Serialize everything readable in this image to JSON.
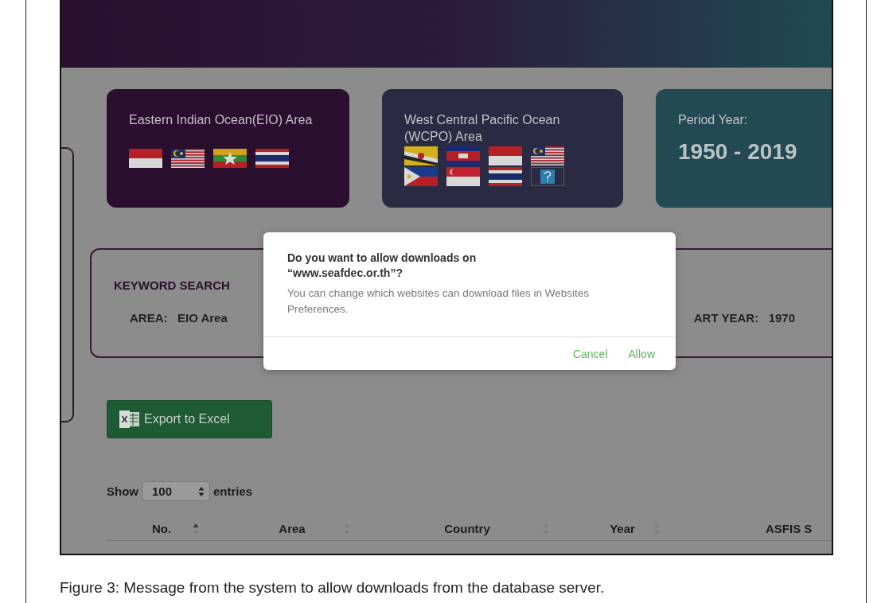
{
  "cards": [
    {
      "kind": "region",
      "title": "Eastern Indian Ocean(EIO) Area"
    },
    {
      "kind": "region",
      "title": "West Central Pacific Ocean (WCPO) Area"
    },
    {
      "kind": "period",
      "label": "Period Year:",
      "value": "1950 - 2019"
    }
  ],
  "keyword_search": {
    "title": "KEYWORD SEARCH",
    "fields": [
      {
        "label": "AREA:",
        "value": "EIO Area"
      },
      {
        "label": "ART YEAR:",
        "value": "1970"
      }
    ]
  },
  "export_button": "Export to Excel",
  "length_control": {
    "prefix": "Show",
    "value": "100",
    "suffix": "entries"
  },
  "table": {
    "columns": [
      {
        "label": "No.",
        "sorted": true
      },
      {
        "label": "Area",
        "sorted": false
      },
      {
        "label": "Country",
        "sorted": false
      },
      {
        "label": "Year",
        "sorted": false
      },
      {
        "label": "ASFIS S"
      }
    ]
  },
  "dialog": {
    "title": "Do you want to allow downloads on “www.seafdec.or.th”?",
    "message": "You can change which websites can download files in Websites Preferences.",
    "buttons": [
      "Cancel",
      "Allow"
    ]
  },
  "caption": "Figure 3: Message from the system to allow downloads from the database server."
}
